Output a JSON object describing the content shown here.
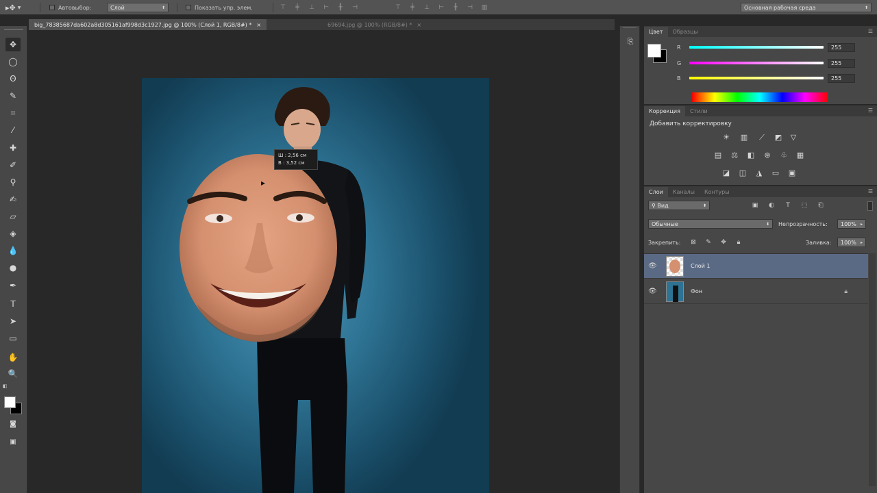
{
  "options_bar": {
    "autoselect_label": "Автовыбор:",
    "autoselect_value": "Слой",
    "show_controls_label": "Показать упр. элем.",
    "workspace_value": "Основная рабочая среда"
  },
  "tabs": [
    {
      "label": "big_78385687da602a8d305161af998d3c1927.jpg @ 100% (Слой 1, RGB/8#) *",
      "close": "×"
    },
    {
      "label": "69694.jpg @ 100% (RGB/8#) *",
      "close": "×"
    }
  ],
  "transform_tooltip": {
    "w": "Ш :  2,56 см",
    "h": "В :  3,52 см"
  },
  "color_panel": {
    "tabs": [
      "Цвет",
      "Образцы"
    ],
    "channels": [
      {
        "label": "R",
        "value": "255"
      },
      {
        "label": "G",
        "value": "255"
      },
      {
        "label": "B",
        "value": "255"
      }
    ],
    "colors": {
      "foreground": "#ffffff",
      "background": "#000000"
    }
  },
  "adjustments_panel": {
    "tabs": [
      "Коррекция",
      "Стили"
    ],
    "heading": "Добавить корректировку"
  },
  "layers_panel": {
    "tabs": [
      "Слои",
      "Каналы",
      "Контуры"
    ],
    "filter_value": "Вид",
    "blend_mode": "Обычные",
    "opacity_label": "Непрозрачность:",
    "opacity_value": "100%",
    "lock_label": "Закрепить:",
    "fill_label": "Заливка:",
    "fill_value": "100%",
    "layers": [
      {
        "name": "Слой 1",
        "selected": true
      },
      {
        "name": "Фон",
        "selected": false
      }
    ]
  }
}
